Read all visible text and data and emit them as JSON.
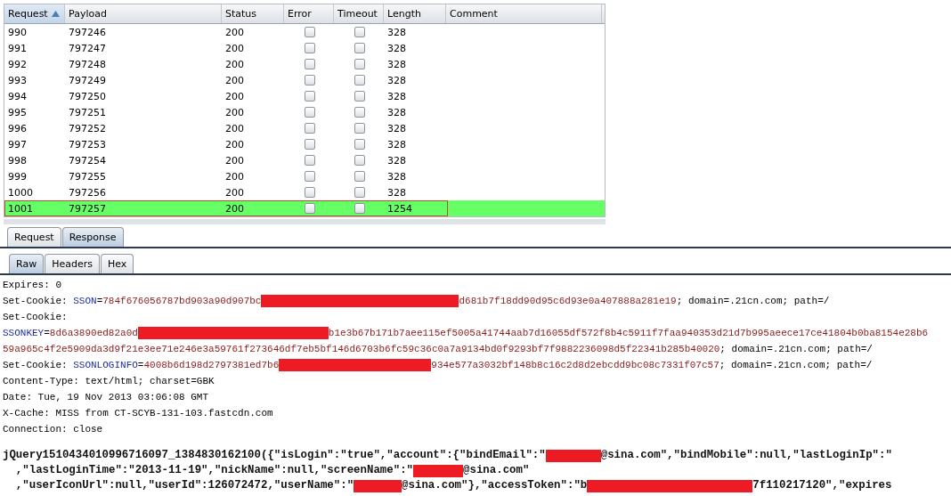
{
  "table": {
    "columns": [
      {
        "label": "Request",
        "sorted": true
      },
      {
        "label": "Payload",
        "sorted": false
      },
      {
        "label": "Status",
        "sorted": false
      },
      {
        "label": "Error",
        "sorted": false
      },
      {
        "label": "Timeout",
        "sorted": false
      },
      {
        "label": "Length",
        "sorted": false
      },
      {
        "label": "Comment",
        "sorted": false
      }
    ],
    "rows": [
      {
        "request": "990",
        "payload": "797246",
        "status": "200",
        "error": false,
        "timeout": false,
        "length": "328",
        "selected": false
      },
      {
        "request": "991",
        "payload": "797247",
        "status": "200",
        "error": false,
        "timeout": false,
        "length": "328",
        "selected": false
      },
      {
        "request": "992",
        "payload": "797248",
        "status": "200",
        "error": false,
        "timeout": false,
        "length": "328",
        "selected": false
      },
      {
        "request": "993",
        "payload": "797249",
        "status": "200",
        "error": false,
        "timeout": false,
        "length": "328",
        "selected": false
      },
      {
        "request": "994",
        "payload": "797250",
        "status": "200",
        "error": false,
        "timeout": false,
        "length": "328",
        "selected": false
      },
      {
        "request": "995",
        "payload": "797251",
        "status": "200",
        "error": false,
        "timeout": false,
        "length": "328",
        "selected": false
      },
      {
        "request": "996",
        "payload": "797252",
        "status": "200",
        "error": false,
        "timeout": false,
        "length": "328",
        "selected": false
      },
      {
        "request": "997",
        "payload": "797253",
        "status": "200",
        "error": false,
        "timeout": false,
        "length": "328",
        "selected": false
      },
      {
        "request": "998",
        "payload": "797254",
        "status": "200",
        "error": false,
        "timeout": false,
        "length": "328",
        "selected": false
      },
      {
        "request": "999",
        "payload": "797255",
        "status": "200",
        "error": false,
        "timeout": false,
        "length": "328",
        "selected": false
      },
      {
        "request": "1000",
        "payload": "797256",
        "status": "200",
        "error": false,
        "timeout": false,
        "length": "328",
        "selected": false
      },
      {
        "request": "1001",
        "payload": "797257",
        "status": "200",
        "error": false,
        "timeout": false,
        "length": "1254",
        "selected": true
      }
    ]
  },
  "tabs": [
    {
      "label": "Request",
      "selected": false
    },
    {
      "label": "Response",
      "selected": true
    }
  ],
  "view_tabs": [
    {
      "label": "Raw",
      "selected": true
    },
    {
      "label": "Headers",
      "selected": false
    },
    {
      "label": "Hex",
      "selected": false
    }
  ],
  "response_lines": [
    {
      "kind": "header",
      "segments": [
        {
          "kind": "text",
          "text": "Expires: 0"
        }
      ]
    },
    {
      "kind": "header",
      "segments": [
        {
          "kind": "text",
          "text": "Set-Cookie: "
        },
        {
          "kind": "key",
          "text": "SSON"
        },
        {
          "kind": "text",
          "text": "="
        },
        {
          "kind": "value",
          "text": "784f676056787bd903a90d907bc"
        },
        {
          "kind": "redacted"
        },
        {
          "kind": "value",
          "text": "d681b7f18dd90d95c6d93e0a407888a281e19"
        },
        {
          "kind": "text",
          "text": "; domain=.21cn.com; path=/"
        }
      ]
    },
    {
      "kind": "header",
      "segments": [
        {
          "kind": "text",
          "text": "Set-Cookie:"
        }
      ]
    },
    {
      "kind": "header",
      "segments": [
        {
          "kind": "key",
          "text": "SSONKEY"
        },
        {
          "kind": "text",
          "text": "="
        },
        {
          "kind": "value",
          "text": "8d6a3890ed82a0d"
        },
        {
          "kind": "redacted"
        },
        {
          "kind": "value",
          "text": "b1e3b67b171b7aee115ef5005a41744aab7d16055df572f8b4c5911f7faa940353d21d7b995aeece17ce41804b0ba8154e28b6"
        }
      ]
    },
    {
      "kind": "header",
      "segments": [
        {
          "kind": "value",
          "text": "59a965c4f2e5909da3d9f21e3ee71e246e3a59761f273646df7eb5bf146d6703b6fc59c36c0a7a9134bd0f9293bf7f9882236098d5f22341b285b40020"
        },
        {
          "kind": "text",
          "text": "; domain=.21cn.com; path=/"
        }
      ]
    },
    {
      "kind": "header",
      "segments": [
        {
          "kind": "text",
          "text": "Set-Cookie: "
        },
        {
          "kind": "key",
          "text": "SSONLOGINFO"
        },
        {
          "kind": "text",
          "text": "="
        },
        {
          "kind": "value",
          "text": "4008b6d198d2797381ed7b6"
        },
        {
          "kind": "redacted"
        },
        {
          "kind": "value",
          "text": "934e577a3032bf148b8c16c2d8d2ebcdd9bc08c7331f07c57"
        },
        {
          "kind": "text",
          "text": "; domain=.21cn.com; path=/"
        }
      ]
    },
    {
      "kind": "header",
      "segments": [
        {
          "kind": "text",
          "text": "Content-Type: text/html; charset=GBK"
        }
      ]
    },
    {
      "kind": "header",
      "segments": [
        {
          "kind": "text",
          "text": "Date: Tue, 19 Nov 2013 03:06:08 GMT"
        }
      ]
    },
    {
      "kind": "header",
      "segments": [
        {
          "kind": "text",
          "text": "X-Cache: MISS from CT-SCYB-131-103.fastcdn.com"
        }
      ]
    },
    {
      "kind": "header",
      "segments": [
        {
          "kind": "text",
          "text": "Connection: close"
        }
      ]
    },
    {
      "kind": "blank"
    },
    {
      "kind": "body",
      "segments": [
        {
          "kind": "text",
          "text": "jQuery1510434010996716097_1384830162100({\"isLogin\":\"true\",\"account\":{\"bindEmail\":\""
        },
        {
          "kind": "redacted"
        },
        {
          "kind": "text",
          "text": "@sina.com\",\"bindMobile\":null,\"lastLoginIp\":\""
        }
      ]
    },
    {
      "kind": "body",
      "segments": [
        {
          "kind": "text",
          "text": "  ,\"lastLoginTime\":\"2013-11-19\",\"nickName\":null,\"screenName\":\""
        },
        {
          "kind": "redacted"
        },
        {
          "kind": "text",
          "text": "@sina.com\""
        }
      ]
    },
    {
      "kind": "body",
      "segments": [
        {
          "kind": "text",
          "text": "  ,\"userIconUrl\":null,\"userId\":126072472,\"userName\":\""
        },
        {
          "kind": "redacted"
        },
        {
          "kind": "text",
          "text": "@sina.com\"},\"accessToken\":\"b"
        },
        {
          "kind": "redacted"
        },
        {
          "kind": "text",
          "text": "7f110217120\",\"expires"
        }
      ]
    }
  ]
}
